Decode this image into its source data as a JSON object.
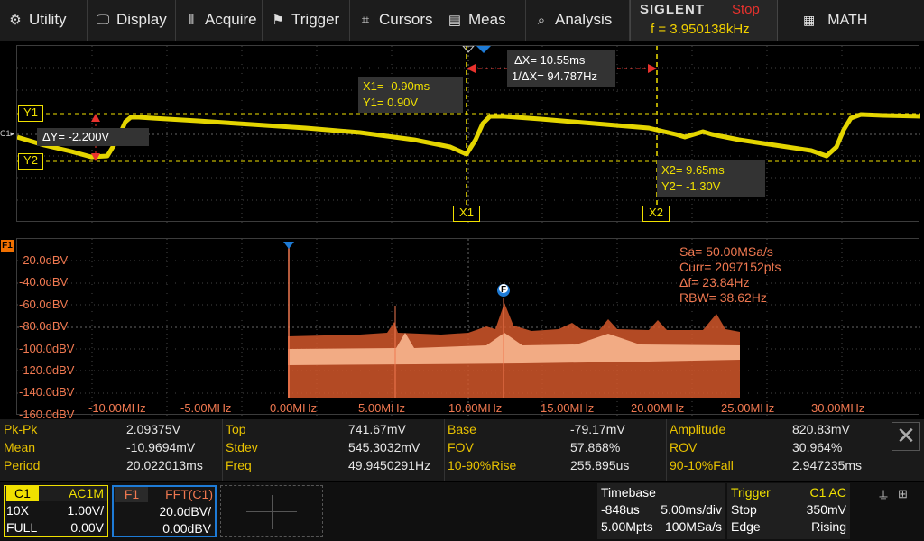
{
  "menu": {
    "items": [
      {
        "label": "Utility",
        "icon": "gear-icon",
        "glyph": "⚙"
      },
      {
        "label": "Display",
        "icon": "monitor-icon",
        "glyph": "🖵"
      },
      {
        "label": "Acquire",
        "icon": "acquire-icon",
        "glyph": "⫴"
      },
      {
        "label": "Trigger",
        "icon": "flag-icon",
        "glyph": "⚑"
      },
      {
        "label": "Cursors",
        "icon": "crosshair-icon",
        "glyph": "⌗"
      },
      {
        "label": "Meas",
        "icon": "ruler-icon",
        "glyph": "▤"
      },
      {
        "label": "Analysis",
        "icon": "analysis-icon",
        "glyph": "⌕"
      }
    ],
    "brand": "SIGLENT",
    "run_state": "Stop",
    "frequency": "f = 3.950138kHz",
    "math_label": "MATH",
    "math_icon": "calculator-icon"
  },
  "cursors": {
    "dx": "ΔX= 10.55ms",
    "inv_dx": "1/ΔX= 94.787Hz",
    "x1_readout": "X1= -0.90ms",
    "y1_readout": "Y1= 0.90V",
    "x2_readout": "X2= 9.65ms",
    "y2_readout": "Y2= -1.30V",
    "dy": "ΔY= -2.200V",
    "y1_tag": "Y1",
    "y2_tag": "Y2",
    "x1_tag": "X1",
    "x2_tag": "X2",
    "c1_tag": "C1"
  },
  "fft": {
    "tag": "F1",
    "marker_tag": "F",
    "sa": "Sa=  50.00MSa/s",
    "curr": "Curr= 2097152pts",
    "df": "Δf=  23.84Hz",
    "rbw": "RBW=  38.62Hz",
    "y_ticks": [
      "-20.0dBV",
      "-40.0dBV",
      "-60.0dBV",
      "-80.0dBV",
      "-100.0dBV",
      "-120.0dBV",
      "-140.0dBV",
      "-160.0dBV"
    ],
    "x_ticks": [
      "-10.00MHz",
      "-5.00MHz",
      "0.00MHz",
      "5.00MHz",
      "10.00MHz",
      "15.00MHz",
      "20.00MHz",
      "25.00MHz",
      "30.00MHz"
    ]
  },
  "measurements": [
    [
      {
        "label": "Pk-Pk",
        "value": "2.09375V"
      },
      {
        "label": "Top",
        "value": "741.67mV"
      },
      {
        "label": "Base",
        "value": "-79.17mV"
      },
      {
        "label": "Amplitude",
        "value": "820.83mV"
      }
    ],
    [
      {
        "label": "Mean",
        "value": "-10.9694mV"
      },
      {
        "label": "Stdev",
        "value": "545.3032mV"
      },
      {
        "label": "FOV",
        "value": "57.868%"
      },
      {
        "label": "ROV",
        "value": "30.964%"
      }
    ],
    [
      {
        "label": "Period",
        "value": "20.022013ms"
      },
      {
        "label": "Freq",
        "value": "49.9450291Hz"
      },
      {
        "label": "10-90%Rise",
        "value": "255.895us"
      },
      {
        "label": "90-10%Fall",
        "value": "2.947235ms"
      }
    ]
  ],
  "channel1": {
    "name": "C1",
    "coupling": "AC1M",
    "probe": "10X",
    "scale": "1.00V/",
    "bw": "FULL",
    "offset": "0.00V"
  },
  "math1": {
    "name": "F1",
    "source": "FFT(C1)",
    "scale": "20.0dBV/",
    "offset": "0.00dBV"
  },
  "timebase": {
    "title": "Timebase",
    "delay": "-848us",
    "scale": "5.00ms/div",
    "points": "5.00Mpts",
    "rate": "100MSa/s"
  },
  "trigger": {
    "title": "Trigger",
    "source": "C1 AC",
    "state": "Stop",
    "level": "350mV",
    "type": "Edge",
    "slope": "Rising"
  },
  "colors": {
    "ch1": "#f0e000",
    "fft": "#f07850",
    "cursor": "#f0e000",
    "marker": "#e8322d",
    "accent": "#1e7bd6"
  }
}
